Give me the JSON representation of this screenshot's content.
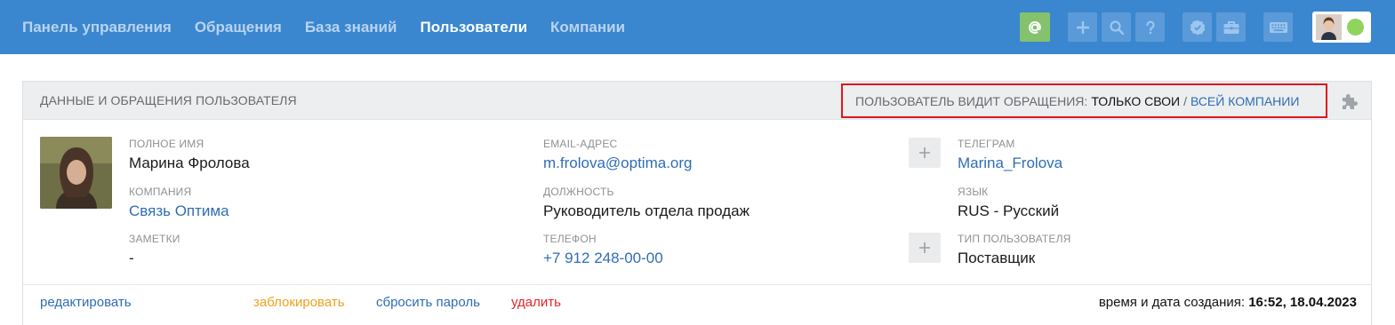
{
  "nav": {
    "items": [
      {
        "label": "Панель управления",
        "active": false
      },
      {
        "label": "Обращения",
        "active": false
      },
      {
        "label": "База знаний",
        "active": false
      },
      {
        "label": "Пользователи",
        "active": true
      },
      {
        "label": "Компании",
        "active": false
      }
    ]
  },
  "toolbar": {
    "icons": [
      "at-icon",
      "plus-icon",
      "search-icon",
      "help-icon",
      "check-badge-icon",
      "briefcase-icon",
      "keyboard-icon",
      "avatar",
      "status-online-indicator"
    ],
    "status_color": "#8fd45c"
  },
  "panel": {
    "title": "ДАННЫЕ И ОБРАЩЕНИЯ ПОЛЬЗОВАТЕЛЯ",
    "visibility": {
      "label": "ПОЛЬЗОВАТЕЛЬ ВИДИТ ОБРАЩЕНИЯ:",
      "current": "ТОЛЬКО СВОИ",
      "separator": "/",
      "other": "ВСЕЙ КОМПАНИИ"
    }
  },
  "user": {
    "full_name_label": "ПОЛНОЕ ИМЯ",
    "full_name": "Марина Фролова",
    "company_label": "КОМПАНИЯ",
    "company": "Связь Оптима",
    "notes_label": "ЗАМЕТКИ",
    "notes": "-",
    "email_label": "EMAIL-АДРЕС",
    "email": "m.frolova@optima.org",
    "position_label": "ДОЛЖНОСТЬ",
    "position": "Руководитель отдела продаж",
    "phone_label": "ТЕЛЕФОН",
    "phone": "+7 912 248-00-00",
    "telegram_label": "ТЕЛЕГРАМ",
    "telegram": "Marina_Frolova",
    "language_label": "ЯЗЫК",
    "language": "RUS - Русский",
    "user_type_label": "ТИП ПОЛЬЗОВАТЕЛЯ",
    "user_type": "Поставщик"
  },
  "actions": {
    "edit": "редактировать",
    "block": "заблокировать",
    "reset_password": "сбросить пароль",
    "delete": "удалить"
  },
  "created": {
    "label": "время и дата создания:",
    "value": "16:52, 18.04.2023"
  }
}
